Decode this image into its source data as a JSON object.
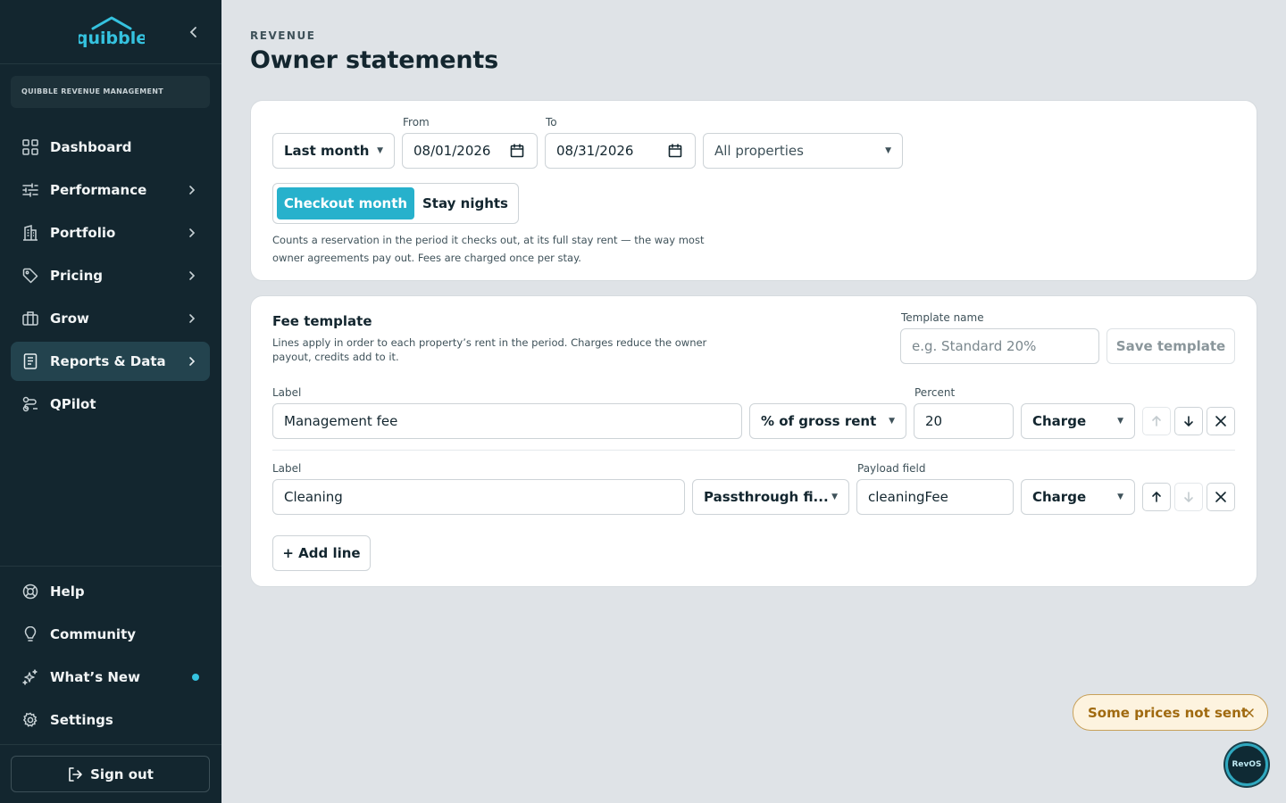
{
  "sidebar": {
    "brand": "quibble",
    "org_name": "QUIBBLE REVENUE MANAGEMENT",
    "nav": [
      {
        "label": "Dashboard",
        "icon": "grid-icon"
      },
      {
        "label": "Performance",
        "icon": "sliders-icon"
      },
      {
        "label": "Portfolio",
        "icon": "building-icon"
      },
      {
        "label": "Pricing",
        "icon": "tag-icon"
      },
      {
        "label": "Grow",
        "icon": "briefcase-icon"
      },
      {
        "label": "Reports & Data",
        "icon": "document-icon",
        "active": true
      },
      {
        "label": "QPilot",
        "icon": "route-icon"
      }
    ],
    "bottom_nav": [
      {
        "label": "Help",
        "icon": "lifebuoy-icon"
      },
      {
        "label": "Community",
        "icon": "lightbulb-icon"
      },
      {
        "label": "What’s New",
        "icon": "sparkles-icon",
        "has_dot": true
      },
      {
        "label": "Settings",
        "icon": "gear-icon"
      }
    ],
    "sign_out": "Sign out"
  },
  "header": {
    "eyebrow": "REVENUE",
    "title": "Owner statements"
  },
  "filters": {
    "period": "Last month",
    "from_label": "From",
    "from_value": "08/01/2026",
    "to_label": "To",
    "to_value": "08/31/2026",
    "properties": "All properties",
    "mode_options": [
      "Checkout month",
      "Stay nights"
    ],
    "mode_selected": "Checkout month",
    "hint": "Counts a reservation in the period it checks out, at its full stay rent — the way most owner agreements pay out. Fees are charged once per stay."
  },
  "fee_template": {
    "title": "Fee template",
    "description": "Lines apply in order to each property’s rent in the period. Charges reduce the owner payout, credits add to it.",
    "template_name_label": "Template name",
    "template_name_placeholder": "e.g. Standard 20%",
    "save_label": "Save template",
    "lines": [
      {
        "label_title": "Label",
        "label_value": "Management fee",
        "basis": "% of gross rent",
        "value_title": "Percent",
        "value": "20",
        "kind": "Charge"
      },
      {
        "label_title": "Label",
        "label_value": "Cleaning",
        "basis": "Passthrough fi...",
        "value_title": "Payload field",
        "value": "cleaningFee",
        "kind": "Charge"
      }
    ],
    "add_line": "+ Add line"
  },
  "toast": {
    "message": "Some prices not sent"
  },
  "assistant": {
    "label": "RevOS"
  },
  "colors": {
    "sidebar_bg": "#13262f",
    "accent": "#27b1cc",
    "page_bg": "#dfe3e7",
    "toast_bg": "#fdf3df",
    "toast_text": "#a06a10"
  }
}
